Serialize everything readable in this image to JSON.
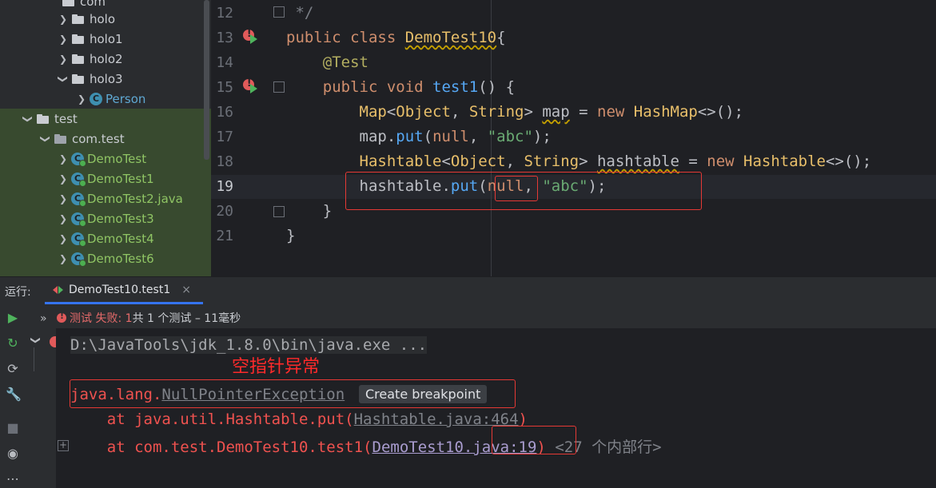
{
  "project_tree": {
    "top_partial": "com",
    "items": [
      {
        "label": "holo",
        "type": "package"
      },
      {
        "label": "holo1",
        "type": "package"
      },
      {
        "label": "holo2",
        "type": "package"
      },
      {
        "label": "holo3",
        "type": "package",
        "expanded": true
      },
      {
        "label": "Person",
        "type": "class"
      },
      {
        "label": "test",
        "type": "folder",
        "expanded": true
      },
      {
        "label": "com.test",
        "type": "package",
        "expanded": true
      },
      {
        "label": "DemoTest",
        "type": "test-class"
      },
      {
        "label": "DemoTest1",
        "type": "test-class"
      },
      {
        "label": "DemoTest2.java",
        "type": "test-class"
      },
      {
        "label": "DemoTest3",
        "type": "test-class"
      },
      {
        "label": "DemoTest4",
        "type": "test-class"
      },
      {
        "label": "DemoTest6",
        "type": "test-class"
      }
    ],
    "class_icon_letter": "C"
  },
  "editor": {
    "line_numbers": [
      "12",
      "13",
      "14",
      "15",
      "16",
      "17",
      "18",
      "19",
      "20",
      "21"
    ],
    "current_line": "19"
  },
  "run_panel": {
    "label": "运行:",
    "tab_label": "DemoTest10.test1",
    "tab_close": "×",
    "status_prefix": "测试 失败: ",
    "status_count": "1",
    "status_rest": "共 1 个测试 – 11毫秒",
    "expand_chevrons": "»"
  },
  "console": {
    "cmd_line": "D:\\JavaTools\\jdk_1.8.0\\bin\\java.exe ...",
    "annotation_note": "空指针异常",
    "exception_pkg": "java.lang.",
    "exception_class": "NullPointerException",
    "tooltip": "Create breakpoint",
    "frame1_prefix": "    at java.util.Hashtable.put(",
    "frame1_link": "Hashtable.java:464",
    "frame1_suffix": ")",
    "frame2_prefix": "    at com.test.DemoTest10.test1(",
    "frame2_link_a": "DemoTest10.",
    "frame2_link_b": "java:19",
    "frame2_suffix": ")",
    "hidden_frames": " <27 个内部行>"
  },
  "colors": {
    "accent": "#3574f0",
    "error": "#f0524f",
    "test_green": "#8fc464",
    "annotation_red": "#ff2a2a"
  }
}
